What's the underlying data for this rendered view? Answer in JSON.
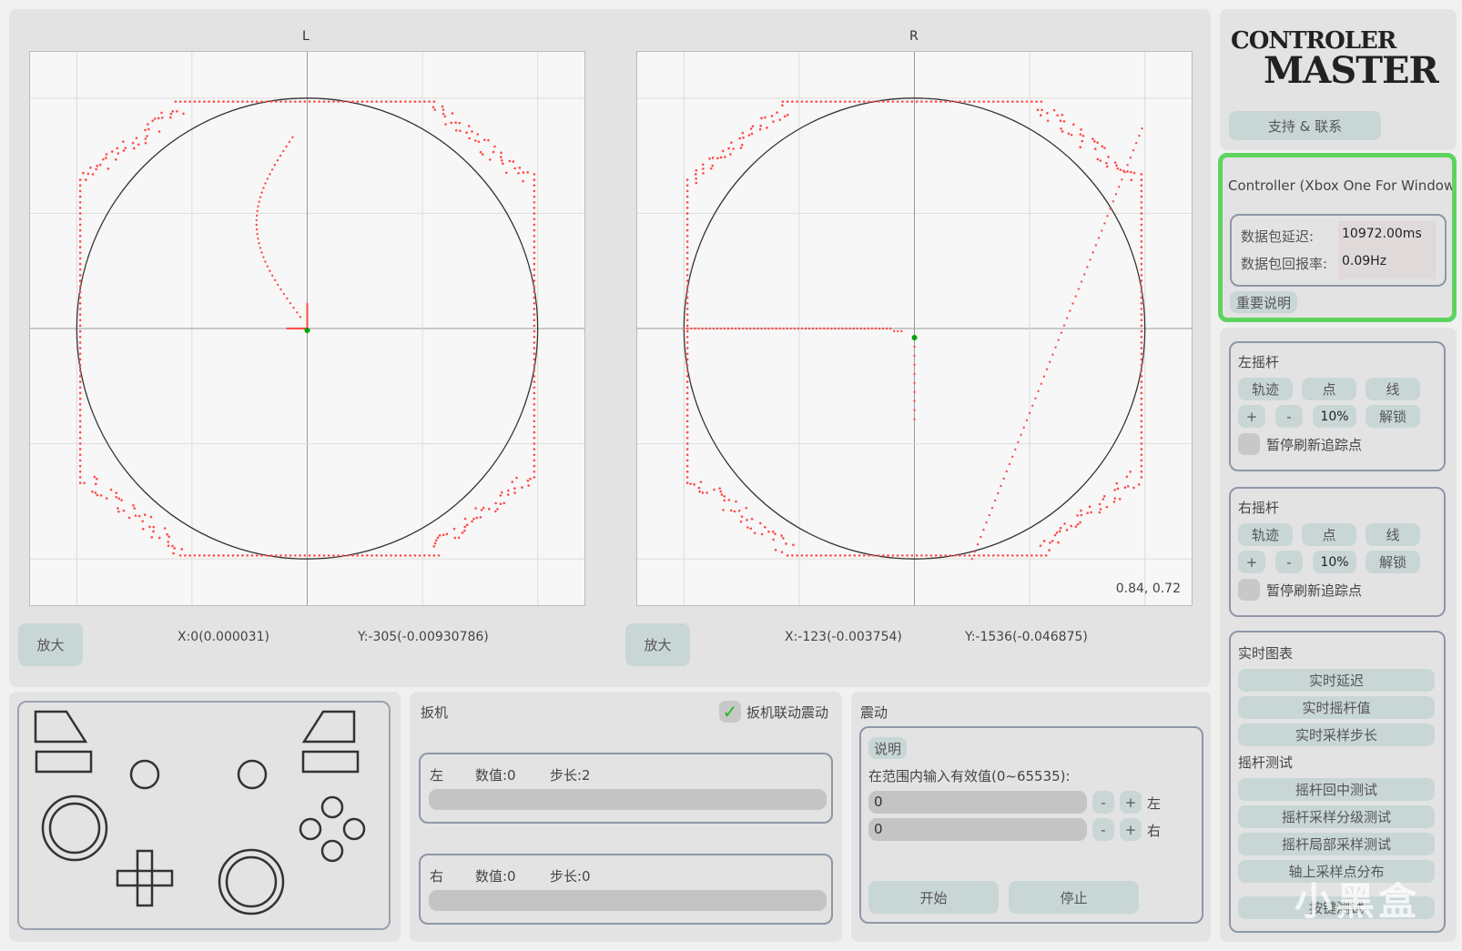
{
  "plots": {
    "left": {
      "title": "L",
      "zoom_label": "放大",
      "x_readout": "X:0(0.000031)",
      "y_readout": "Y:-305(-0.00930786)"
    },
    "right": {
      "title": "R",
      "zoom_label": "放大",
      "x_readout": "X:-123(-0.003754)",
      "y_readout": "Y:-1536(-0.046875)",
      "corner_value": "0.84, 0.72"
    },
    "trace_color": "#ff4a4a",
    "center_color": "#00a000"
  },
  "sidebar": {
    "logo_line1": "CONTROLER",
    "logo_line2": "MASTER",
    "support_label": "支持 & 联系",
    "device_name": "Controller (Xbox One For Windows)",
    "latency_label": "数据包延迟:",
    "latency_value": "10972.00ms",
    "rate_label": "数据包回报率:",
    "rate_value": "0.09Hz",
    "important_label": "重要说明",
    "highlight_color": "#5fd35f",
    "left_stick": {
      "title": "左摇杆",
      "trace": "轨迹",
      "point": "点",
      "line": "线",
      "plus": "+",
      "minus": "-",
      "percent": "10%",
      "unlock": "解锁",
      "pause": "暂停刷新追踪点"
    },
    "right_stick": {
      "title": "右摇杆",
      "trace": "轨迹",
      "point": "点",
      "line": "线",
      "plus": "+",
      "minus": "-",
      "percent": "10%",
      "unlock": "解锁",
      "pause": "暂停刷新追踪点"
    },
    "realtime_title": "实时图表",
    "realtime_buttons": [
      "实时延迟",
      "实时摇杆值",
      "实时采样步长"
    ],
    "test_title": "摇杆测试",
    "test_buttons": [
      "摇杆回中测试",
      "摇杆采样分级测试",
      "摇杆局部采样测试",
      "轴上采样点分布",
      "按键测试"
    ],
    "watermark": "小黑盒"
  },
  "trigger": {
    "title": "扳机",
    "link_label": "扳机联动震动",
    "link_checked": true,
    "left": {
      "side": "左",
      "value": "数值:0",
      "step": "步长:2",
      "level": 0
    },
    "right": {
      "side": "右",
      "value": "数值:0",
      "step": "步长:0",
      "level": 0
    }
  },
  "vibration": {
    "title": "震动",
    "help_label": "说明",
    "range_label": "在范围内输入有效值(0~65535):",
    "left_value": "0",
    "right_value": "0",
    "minus": "-",
    "plus": "+",
    "left_label": "左",
    "right_label": "右",
    "start_label": "开始",
    "stop_label": "停止"
  }
}
